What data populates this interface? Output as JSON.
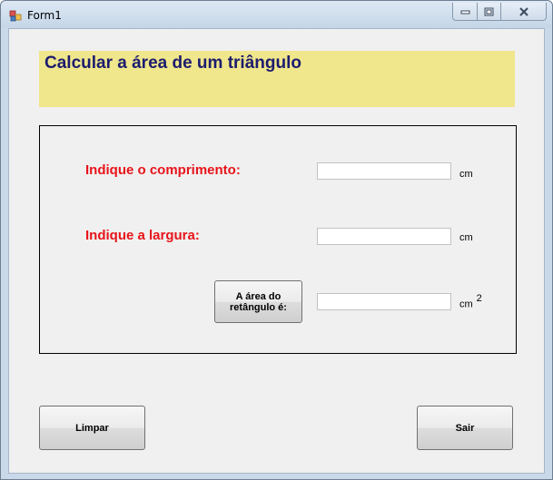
{
  "window": {
    "title": "Form1",
    "icons": {
      "app": "form-app-icon",
      "minimize": "minimize-icon",
      "maximize": "maximize-icon",
      "close": "close-icon"
    }
  },
  "header": {
    "title": "Calcular a área de um triângulo",
    "background": "#f0e68c",
    "title_color": "#1c1c6e"
  },
  "form": {
    "label_color": "#e8141a",
    "length": {
      "label": "Indique o comprimento:",
      "value": "",
      "unit": "cm"
    },
    "width": {
      "label": "Indique a largura:",
      "value": "",
      "unit": "cm"
    },
    "area": {
      "button_label": "A área do retângulo é:",
      "value": "",
      "unit": "cm",
      "unit_exponent": "2"
    }
  },
  "buttons": {
    "clear": "Limpar",
    "exit": "Sair"
  }
}
